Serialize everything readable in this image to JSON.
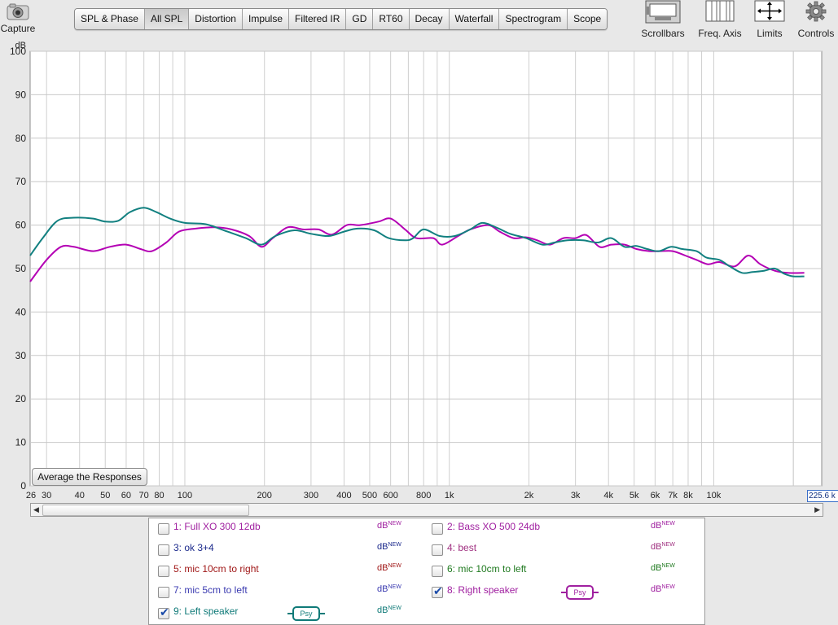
{
  "toolbar": {
    "capture_label": "Capture",
    "tabs": [
      {
        "label": "SPL & Phase",
        "active": false
      },
      {
        "label": "All SPL",
        "active": true
      },
      {
        "label": "Distortion",
        "active": false
      },
      {
        "label": "Impulse",
        "active": false
      },
      {
        "label": "Filtered IR",
        "active": false
      },
      {
        "label": "GD",
        "active": false
      },
      {
        "label": "RT60",
        "active": false
      },
      {
        "label": "Decay",
        "active": false
      },
      {
        "label": "Waterfall",
        "active": false
      },
      {
        "label": "Spectrogram",
        "active": false
      },
      {
        "label": "Scope",
        "active": false
      }
    ],
    "scrollbars_label": "Scrollbars",
    "freq_axis_label": "Freq. Axis",
    "limits_label": "Limits",
    "controls_label": "Controls"
  },
  "average_button": "Average the Responses",
  "freq_field_value": "25.6 k",
  "freq_field_prefix": "2",
  "legend": {
    "unit_label": "dB",
    "unit_sup": "NEW",
    "psy_label": "Psy",
    "items": [
      {
        "label": "1: Full XO 300 12db",
        "color": "#a020a0",
        "checked": false,
        "psy": false
      },
      {
        "label": "2: Bass XO 500 24db",
        "color": "#a020a0",
        "checked": false,
        "psy": false
      },
      {
        "label": "3: ok 3+4",
        "color": "#1c2a8c",
        "checked": false,
        "psy": false
      },
      {
        "label": "4: best",
        "color": "#a03080",
        "checked": false,
        "psy": false
      },
      {
        "label": "5: mic 10cm to right",
        "color": "#a01818",
        "checked": false,
        "psy": false
      },
      {
        "label": "6: mic 10cm to left",
        "color": "#207a20",
        "checked": false,
        "psy": false
      },
      {
        "label": "7: mic 5cm to left",
        "color": "#3a3ab0",
        "checked": false,
        "psy": false
      },
      {
        "label": "8: Right speaker",
        "color": "#a020a0",
        "checked": true,
        "psy": true
      },
      {
        "label": "9: Left speaker",
        "color": "#0f7a78",
        "checked": true,
        "psy": true
      }
    ]
  },
  "chart_data": {
    "type": "line",
    "ylabel": "dB",
    "xscale": "log",
    "xlim": [
      26,
      25600
    ],
    "ylim": [
      0,
      100
    ],
    "yticks": [
      0,
      10,
      20,
      30,
      40,
      50,
      60,
      70,
      80,
      90,
      100
    ],
    "xticks": [
      {
        "value": 26,
        "label": "26"
      },
      {
        "value": 30,
        "label": "30"
      },
      {
        "value": 40,
        "label": "40"
      },
      {
        "value": 50,
        "label": "50"
      },
      {
        "value": 60,
        "label": "60"
      },
      {
        "value": 70,
        "label": "70"
      },
      {
        "value": 80,
        "label": "80"
      },
      {
        "value": 100,
        "label": "100"
      },
      {
        "value": 200,
        "label": "200"
      },
      {
        "value": 300,
        "label": "300"
      },
      {
        "value": 400,
        "label": "400"
      },
      {
        "value": 500,
        "label": "500"
      },
      {
        "value": 600,
        "label": "600"
      },
      {
        "value": 800,
        "label": "800"
      },
      {
        "value": 1000,
        "label": "1k"
      },
      {
        "value": 2000,
        "label": "2k"
      },
      {
        "value": 3000,
        "label": "3k"
      },
      {
        "value": 4000,
        "label": "4k"
      },
      {
        "value": 5000,
        "label": "5k"
      },
      {
        "value": 6000,
        "label": "6k"
      },
      {
        "value": 7000,
        "label": "7k"
      },
      {
        "value": 8000,
        "label": "8k"
      },
      {
        "value": 10000,
        "label": "10k"
      }
    ],
    "grid": true,
    "series": [
      {
        "name": "8: Right speaker",
        "color": "#b400b4",
        "points": [
          [
            26,
            47
          ],
          [
            30,
            52
          ],
          [
            34,
            55
          ],
          [
            38,
            55
          ],
          [
            45,
            54
          ],
          [
            52,
            55
          ],
          [
            60,
            55.5
          ],
          [
            68,
            54.5
          ],
          [
            75,
            54
          ],
          [
            85,
            56
          ],
          [
            95,
            58.5
          ],
          [
            110,
            59.2
          ],
          [
            130,
            59.5
          ],
          [
            150,
            59
          ],
          [
            175,
            57.5
          ],
          [
            195,
            55
          ],
          [
            215,
            57
          ],
          [
            245,
            59.5
          ],
          [
            280,
            59
          ],
          [
            320,
            59
          ],
          [
            360,
            57.8
          ],
          [
            410,
            60
          ],
          [
            460,
            60
          ],
          [
            540,
            60.8
          ],
          [
            600,
            61.5
          ],
          [
            680,
            59
          ],
          [
            750,
            57
          ],
          [
            870,
            57
          ],
          [
            940,
            55.5
          ],
          [
            1080,
            57.5
          ],
          [
            1200,
            59
          ],
          [
            1400,
            60
          ],
          [
            1550,
            58.5
          ],
          [
            1750,
            57
          ],
          [
            1950,
            57.2
          ],
          [
            2150,
            56.5
          ],
          [
            2400,
            55.5
          ],
          [
            2700,
            57
          ],
          [
            3000,
            57
          ],
          [
            3300,
            57.7
          ],
          [
            3700,
            55
          ],
          [
            4100,
            55.5
          ],
          [
            4600,
            55.5
          ],
          [
            5100,
            54.5
          ],
          [
            5700,
            54
          ],
          [
            6300,
            54
          ],
          [
            7000,
            54
          ],
          [
            7800,
            53
          ],
          [
            8600,
            52
          ],
          [
            9500,
            51
          ],
          [
            10500,
            51.5
          ],
          [
            12000,
            50.5
          ],
          [
            13500,
            53
          ],
          [
            15000,
            51
          ],
          [
            17000,
            49.5
          ],
          [
            19000,
            49
          ],
          [
            22000,
            49
          ]
        ]
      },
      {
        "name": "9: Left speaker",
        "color": "#128080",
        "points": [
          [
            26,
            53
          ],
          [
            29,
            57
          ],
          [
            33,
            61
          ],
          [
            38,
            61.7
          ],
          [
            45,
            61.5
          ],
          [
            50,
            60.8
          ],
          [
            56,
            61
          ],
          [
            62,
            63
          ],
          [
            70,
            64
          ],
          [
            78,
            63
          ],
          [
            88,
            61.5
          ],
          [
            100,
            60.5
          ],
          [
            120,
            60.2
          ],
          [
            145,
            58.5
          ],
          [
            170,
            57
          ],
          [
            195,
            55.5
          ],
          [
            220,
            57.5
          ],
          [
            260,
            58.8
          ],
          [
            300,
            58
          ],
          [
            350,
            57.5
          ],
          [
            400,
            58.5
          ],
          [
            450,
            59.2
          ],
          [
            520,
            58.8
          ],
          [
            590,
            57
          ],
          [
            680,
            56.5
          ],
          [
            730,
            57
          ],
          [
            800,
            59
          ],
          [
            920,
            57.5
          ],
          [
            1050,
            57.5
          ],
          [
            1200,
            59
          ],
          [
            1330,
            60.5
          ],
          [
            1500,
            59.5
          ],
          [
            1700,
            58
          ],
          [
            1950,
            57
          ],
          [
            2250,
            55.5
          ],
          [
            2500,
            56
          ],
          [
            2800,
            56.5
          ],
          [
            3200,
            56.5
          ],
          [
            3650,
            56
          ],
          [
            4100,
            57
          ],
          [
            4600,
            55
          ],
          [
            5100,
            55.2
          ],
          [
            5600,
            54.5
          ],
          [
            6200,
            54
          ],
          [
            6900,
            55
          ],
          [
            7600,
            54.5
          ],
          [
            8600,
            54
          ],
          [
            9400,
            52.5
          ],
          [
            10500,
            52
          ],
          [
            11500,
            50.5
          ],
          [
            12800,
            49
          ],
          [
            14000,
            49.2
          ],
          [
            15500,
            49.5
          ],
          [
            17000,
            50
          ],
          [
            18500,
            48.8
          ],
          [
            20000,
            48.2
          ],
          [
            22000,
            48.2
          ]
        ]
      }
    ]
  }
}
